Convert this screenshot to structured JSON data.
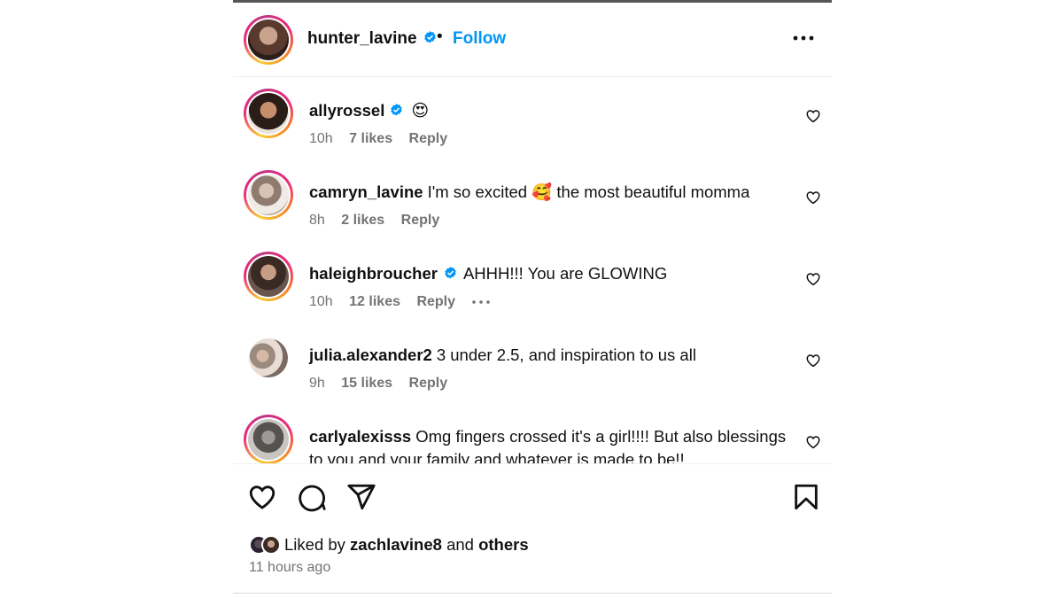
{
  "header": {
    "username": "hunter_lavine",
    "separator": "•",
    "follow_label": "Follow",
    "more_icon": "more-horizontal-icon"
  },
  "comments": [
    {
      "username": "allyrossel",
      "verified": true,
      "text": "",
      "emoji": "😍",
      "time": "10h",
      "likes": "7 likes",
      "reply": "Reply",
      "ring": true
    },
    {
      "username": "camryn_lavine",
      "verified": false,
      "text": "I'm so excited 🥰 the most beautiful momma",
      "time": "8h",
      "likes": "2 likes",
      "reply": "Reply",
      "ring": true
    },
    {
      "username": "haleighbroucher",
      "verified": true,
      "text": "AHHH!!! You are GLOWING",
      "time": "10h",
      "likes": "12 likes",
      "reply": "Reply",
      "ring": true
    },
    {
      "username": "julia.alexander2",
      "verified": false,
      "text": "3 under 2.5, and inspiration to us all",
      "time": "9h",
      "likes": "15 likes",
      "reply": "Reply",
      "ring": false
    },
    {
      "username": "carlyalexisss",
      "verified": false,
      "text": "Omg fingers crossed it's a girl!!!! But also blessings to you and your family and whatever is made to be!!",
      "time": "",
      "likes": "",
      "reply": "",
      "ring": true
    }
  ],
  "actions": {
    "like_icon": "heart-icon",
    "comment_icon": "comment-icon",
    "share_icon": "send-icon",
    "save_icon": "bookmark-icon"
  },
  "likes_summary": {
    "prefix": "Liked by",
    "user": "zachlavine8",
    "middle": "and",
    "others": "others"
  },
  "timestamp": "11 hours ago",
  "colors": {
    "accent": "#0095f6",
    "muted": "#737373",
    "verified": "#0095f6"
  }
}
